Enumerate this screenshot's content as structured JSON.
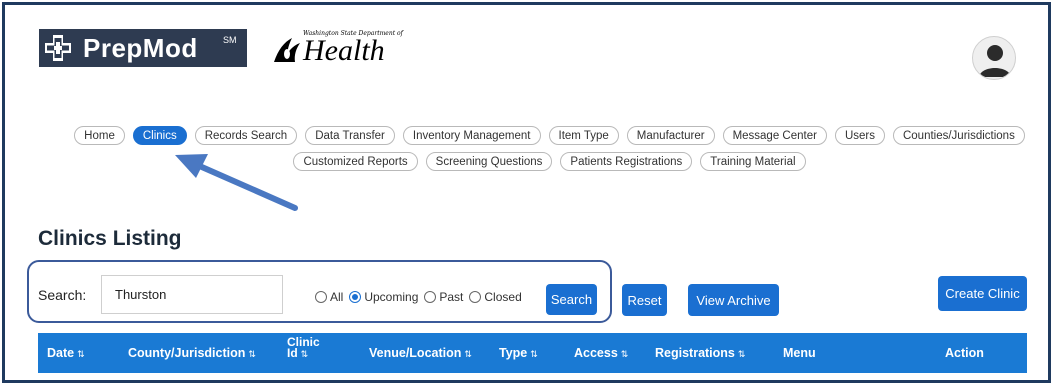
{
  "header": {
    "brand": "PrepMod",
    "brand_sm": "SM",
    "partner_top": "Washington State Department of",
    "partner_name": "Health"
  },
  "nav": {
    "row1": [
      "Home",
      "Clinics",
      "Records Search",
      "Data Transfer",
      "Inventory Management",
      "Item Type",
      "Manufacturer",
      "Message Center",
      "Users",
      "Counties/Jurisdictions"
    ],
    "row2": [
      "Customized Reports",
      "Screening Questions",
      "Patients Registrations",
      "Training Material"
    ],
    "active": "Clinics"
  },
  "page": {
    "title": "Clinics Listing"
  },
  "search": {
    "label": "Search:",
    "value": "Thurston",
    "filters": [
      {
        "label": "All",
        "checked": false
      },
      {
        "label": "Upcoming",
        "checked": true
      },
      {
        "label": "Past",
        "checked": false
      },
      {
        "label": "Closed",
        "checked": false
      }
    ],
    "search_button": "Search",
    "reset_button": "Reset",
    "archive_button": "View Archive",
    "create_button": "Create Clinic"
  },
  "table": {
    "columns": [
      "Date",
      "County/Jurisdiction",
      "Clinic Id",
      "Venue/Location",
      "Type",
      "Access",
      "Registrations",
      "Menu",
      "Action"
    ],
    "clinic_id_line1": "Clinic",
    "clinic_id_line2": "Id",
    "sort_glyph": "⇅"
  },
  "colors": {
    "accent": "#1a6fd1",
    "header_bar": "#1a7ad4",
    "frame": "#1f3a5f",
    "logo_bg": "#2e3b51"
  },
  "icons": [
    "prepmod-cross-icon",
    "wa-health-icon",
    "user-avatar-icon",
    "annotation-arrow-icon",
    "sort-icon"
  ]
}
